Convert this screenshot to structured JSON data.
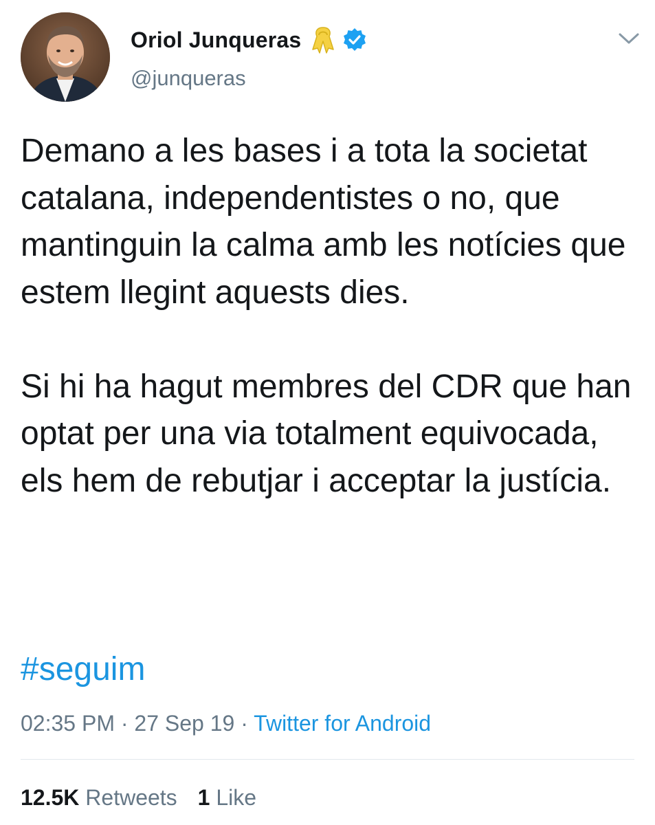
{
  "author": {
    "display_name": "Oriol Junqueras",
    "handle": "@junqueras",
    "name_icons": [
      "yellow-ribbon-icon",
      "verified-badge-icon"
    ],
    "avatar": "profile-photo"
  },
  "tweet": {
    "paragraph_1": "Demano a les bases i a tota la societat catalana, independentistes o no, que mantinguin la calma amb les notícies que estem llegint aquests dies.",
    "paragraph_2": "Si hi ha hagut membres del CDR que han optat per una via totalment equivocada, els hem de rebutjar i acceptar la justícia.",
    "hashtag": "#seguim"
  },
  "meta": {
    "time": "02:35 PM",
    "separator": " · ",
    "date": "27 Sep 19",
    "source": "Twitter for Android"
  },
  "stats": {
    "retweets_count": "12.5K",
    "retweets_label": "Retweets",
    "likes_count": "1",
    "likes_label": "Like"
  },
  "colors": {
    "text": "#14171a",
    "secondary": "#657786",
    "link": "#1b95e0",
    "verified": "#1da1f2",
    "ribbon": "#f5d142",
    "divider": "#e1e8ed"
  }
}
